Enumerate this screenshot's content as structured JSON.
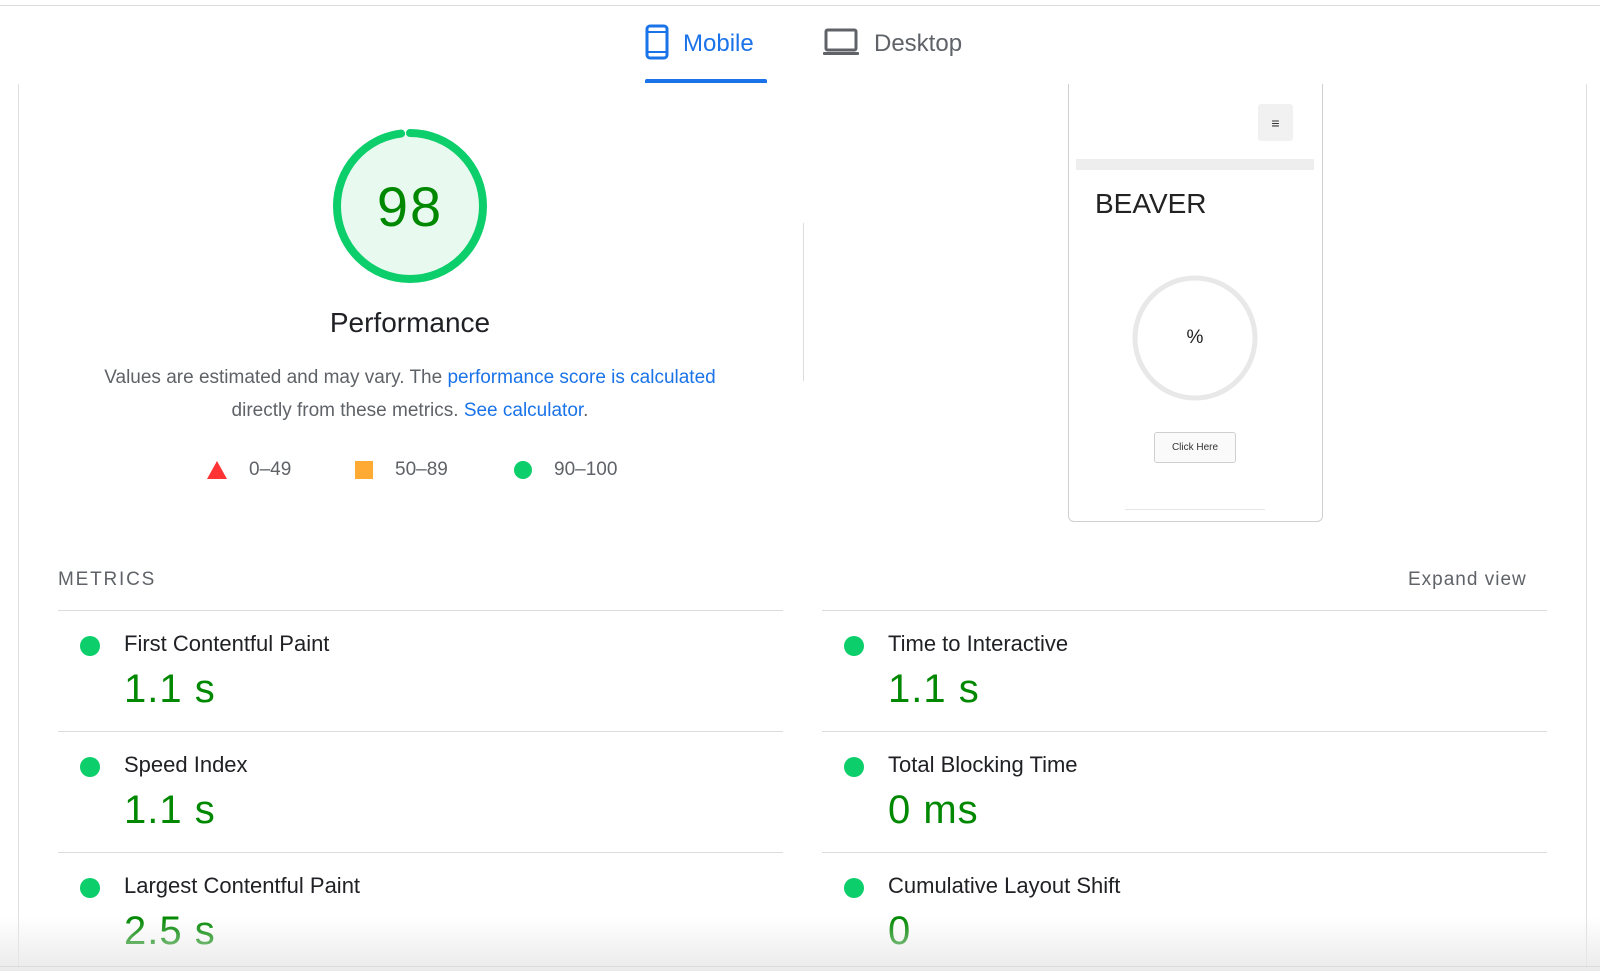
{
  "tabs": [
    {
      "label": "Mobile",
      "icon": "mobile-phone-icon",
      "active": true
    },
    {
      "label": "Desktop",
      "icon": "laptop-icon",
      "active": false
    }
  ],
  "score": {
    "value": "98",
    "title": "Performance",
    "description_prefix": "Values are estimated and may vary. The ",
    "description_link": "performance score is calculated",
    "description_middle": " directly from these metrics. ",
    "calculator_link": "See calculator",
    "description_suffix": "."
  },
  "legend": [
    {
      "range": "0–49",
      "shape": "triangle",
      "color": "#ff3333"
    },
    {
      "range": "50–89",
      "shape": "square",
      "color": "#ffaa33"
    },
    {
      "range": "90–100",
      "shape": "circle",
      "color": "#0cce6b"
    }
  ],
  "preview": {
    "menu_glyph": "≡",
    "title": "BEAVER",
    "ring_text": "%",
    "button": "Click Here"
  },
  "metrics": {
    "header": "METRICS",
    "expand": "Expand view",
    "left": [
      {
        "name": "First Contentful Paint",
        "value": "1.1 s"
      },
      {
        "name": "Speed Index",
        "value": "1.1 s"
      },
      {
        "name": "Largest Contentful Paint",
        "value": "2.5 s"
      }
    ],
    "right": [
      {
        "name": "Time to Interactive",
        "value": "1.1 s"
      },
      {
        "name": "Total Blocking Time",
        "value": "0 ms"
      },
      {
        "name": "Cumulative Layout Shift",
        "value": "0"
      }
    ]
  },
  "colors": {
    "pass": "#0cce6b",
    "pass_text": "#008800",
    "accent": "#1a73e8",
    "average": "#ffaa33",
    "fail": "#ff3333"
  }
}
